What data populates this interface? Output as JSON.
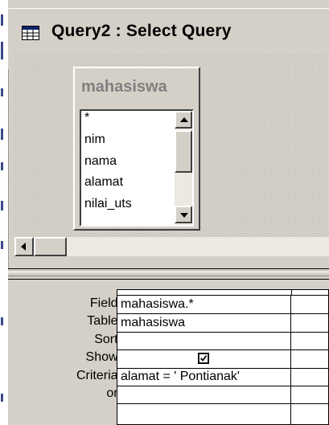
{
  "window": {
    "title": "Query2 : Select Query",
    "icon": "datasheet-window-icon"
  },
  "table_box": {
    "name": "mahasiswa",
    "fields": [
      "*",
      "nim",
      "nama",
      "alamat",
      "nilai_uts"
    ]
  },
  "grid": {
    "labels": {
      "field": "Field:",
      "table": "Table:",
      "sort": "Sort:",
      "show": "Show:",
      "criteria": "Criteria:",
      "or": "or:"
    },
    "column1": {
      "field": "mahasiswa.*",
      "table": "mahasiswa",
      "sort": "",
      "show": true,
      "criteria": "alamat = ' Pontianak'",
      "or": ""
    }
  }
}
